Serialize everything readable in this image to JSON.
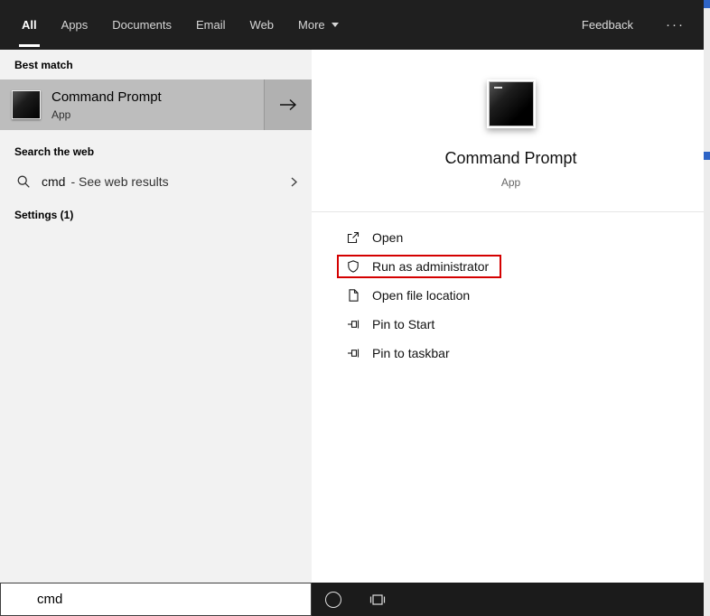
{
  "topbar": {
    "tabs": [
      {
        "label": "All",
        "selected": true
      },
      {
        "label": "Apps"
      },
      {
        "label": "Documents"
      },
      {
        "label": "Email"
      },
      {
        "label": "Web"
      },
      {
        "label": "More"
      }
    ],
    "feedback_label": "Feedback",
    "more_options": "···"
  },
  "left_panel": {
    "best_match_header": "Best match",
    "best_match": {
      "title": "Command Prompt",
      "subtitle": "App"
    },
    "search_web_header": "Search the web",
    "web_suggestion": {
      "query": "cmd",
      "suffix": "- See web results"
    },
    "settings_header": "Settings (1)"
  },
  "right_panel": {
    "app_title": "Command Prompt",
    "app_subtitle": "App",
    "actions": [
      {
        "label": "Open",
        "icon": "open-icon",
        "highlighted": false
      },
      {
        "label": "Run as administrator",
        "icon": "shield-icon",
        "highlighted": true
      },
      {
        "label": "Open file location",
        "icon": "file-location-icon",
        "highlighted": false
      },
      {
        "label": "Pin to Start",
        "icon": "pin-icon",
        "highlighted": false
      },
      {
        "label": "Pin to taskbar",
        "icon": "pin-icon",
        "highlighted": false
      }
    ]
  },
  "bottombar": {
    "search_value": "cmd"
  },
  "colors": {
    "topbar-bg": "#1f1f1f",
    "taskbar-bg": "#1b1b1b",
    "panel-bg": "#f2f2f2",
    "selected-item-bg": "#bdbdbd",
    "selected-arrow-bg": "#b1b1b1",
    "highlight-red": "#d40000",
    "accent-blue": "#2e64c6"
  }
}
